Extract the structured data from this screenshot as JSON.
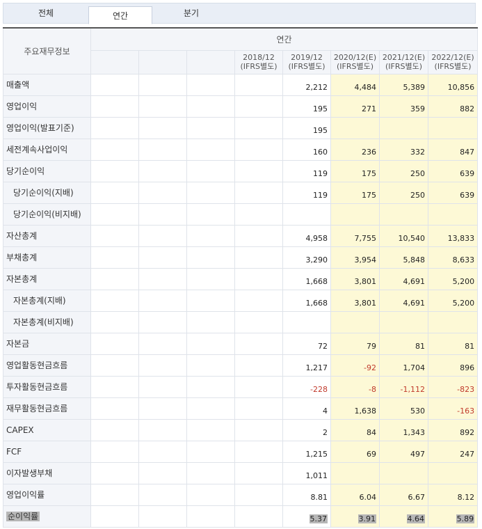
{
  "tabs": [
    {
      "label": "전체",
      "active": false
    },
    {
      "label": "연간",
      "active": true
    },
    {
      "label": "분기",
      "active": false
    }
  ],
  "table": {
    "corner_label": "주요재무정보",
    "group_header": "연간",
    "columns": [
      {
        "period": "",
        "basis": ""
      },
      {
        "period": "",
        "basis": ""
      },
      {
        "period": "",
        "basis": ""
      },
      {
        "period": "2018/12",
        "basis": "(IFRS별도)"
      },
      {
        "period": "2019/12",
        "basis": "(IFRS별도)"
      },
      {
        "period": "2020/12(E)",
        "basis": "(IFRS별도)"
      },
      {
        "period": "2021/12(E)",
        "basis": "(IFRS별도)"
      },
      {
        "period": "2022/12(E)",
        "basis": "(IFRS별도)"
      }
    ],
    "rows": [
      {
        "label": "매출액",
        "indent": false,
        "values": [
          "",
          "",
          "",
          "",
          "2,212",
          "4,484",
          "5,389",
          "10,856"
        ]
      },
      {
        "label": "영업이익",
        "indent": false,
        "values": [
          "",
          "",
          "",
          "",
          "195",
          "271",
          "359",
          "882"
        ]
      },
      {
        "label": "영업이익(발표기준)",
        "indent": false,
        "values": [
          "",
          "",
          "",
          "",
          "195",
          "",
          "",
          ""
        ]
      },
      {
        "label": "세전계속사업이익",
        "indent": false,
        "values": [
          "",
          "",
          "",
          "",
          "160",
          "236",
          "332",
          "847"
        ]
      },
      {
        "label": "당기순이익",
        "indent": false,
        "values": [
          "",
          "",
          "",
          "",
          "119",
          "175",
          "250",
          "639"
        ]
      },
      {
        "label": "당기순이익(지배)",
        "indent": true,
        "values": [
          "",
          "",
          "",
          "",
          "119",
          "175",
          "250",
          "639"
        ]
      },
      {
        "label": "당기순이익(비지배)",
        "indent": true,
        "values": [
          "",
          "",
          "",
          "",
          "",
          "",
          "",
          ""
        ]
      },
      {
        "label": "자산총계",
        "indent": false,
        "values": [
          "",
          "",
          "",
          "",
          "4,958",
          "7,755",
          "10,540",
          "13,833"
        ]
      },
      {
        "label": "부채총계",
        "indent": false,
        "values": [
          "",
          "",
          "",
          "",
          "3,290",
          "3,954",
          "5,848",
          "8,633"
        ]
      },
      {
        "label": "자본총계",
        "indent": false,
        "values": [
          "",
          "",
          "",
          "",
          "1,668",
          "3,801",
          "4,691",
          "5,200"
        ]
      },
      {
        "label": "자본총계(지배)",
        "indent": true,
        "values": [
          "",
          "",
          "",
          "",
          "1,668",
          "3,801",
          "4,691",
          "5,200"
        ]
      },
      {
        "label": "자본총계(비지배)",
        "indent": true,
        "values": [
          "",
          "",
          "",
          "",
          "",
          "",
          "",
          ""
        ]
      },
      {
        "label": "자본금",
        "indent": false,
        "values": [
          "",
          "",
          "",
          "",
          "72",
          "79",
          "81",
          "81"
        ]
      },
      {
        "label": "영업활동현금흐름",
        "indent": false,
        "values": [
          "",
          "",
          "",
          "",
          "1,217",
          "-92",
          "1,704",
          "896"
        ]
      },
      {
        "label": "투자활동현금흐름",
        "indent": false,
        "values": [
          "",
          "",
          "",
          "",
          "-228",
          "-8",
          "-1,112",
          "-823"
        ]
      },
      {
        "label": "재무활동현금흐름",
        "indent": false,
        "values": [
          "",
          "",
          "",
          "",
          "4",
          "1,638",
          "530",
          "-163"
        ]
      },
      {
        "label": "CAPEX",
        "indent": false,
        "values": [
          "",
          "",
          "",
          "",
          "2",
          "84",
          "1,343",
          "892"
        ]
      },
      {
        "label": "FCF",
        "indent": false,
        "values": [
          "",
          "",
          "",
          "",
          "1,215",
          "69",
          "497",
          "247"
        ]
      },
      {
        "label": "이자발생부채",
        "indent": false,
        "values": [
          "",
          "",
          "",
          "",
          "1,011",
          "",
          "",
          ""
        ]
      },
      {
        "label": "영업이익률",
        "indent": false,
        "values": [
          "",
          "",
          "",
          "",
          "8.81",
          "6.04",
          "6.67",
          "8.12"
        ]
      },
      {
        "label": "순이익률",
        "indent": false,
        "selected": true,
        "values": [
          "",
          "",
          "",
          "",
          "5.37",
          "3.91",
          "4.64",
          "5.89"
        ]
      }
    ]
  },
  "colors": {
    "estimate_bg": "#fdf9d6",
    "negative": "#c0392b",
    "header_bg": "#f3f5f9",
    "selection": "#b7b7b7"
  }
}
